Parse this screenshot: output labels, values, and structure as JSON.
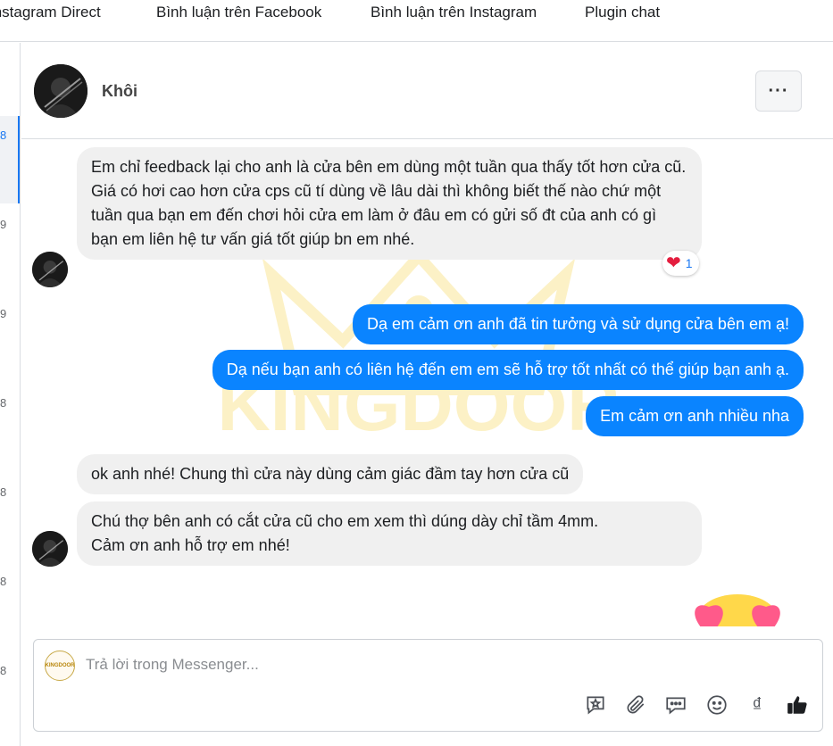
{
  "tabs": [
    {
      "label": "Instagram Direct"
    },
    {
      "label": "Bình luận trên Facebook"
    },
    {
      "label": "Bình luận trên Instagram"
    },
    {
      "label": "Plugin chat"
    }
  ],
  "left_list": {
    "numbers": [
      "8",
      "9",
      "9",
      "8",
      "8",
      "8",
      "8"
    ]
  },
  "conversation": {
    "contact_name": "Khôi",
    "more_label": "···"
  },
  "messages": [
    {
      "direction": "in",
      "text": "Em chỉ feedback lại cho anh là cửa bên em dùng một tuần qua thấy tốt hơn cửa cũ. Giá có hơi cao hơn cửa cps cũ tí dùng về lâu dài thì không biết thế nào chứ một tuần qua bạn em đến chơi hỏi cửa em làm ở đâu em có gửi số đt của anh có gì bạn em liên hệ tư vấn giá tốt giúp bn em nhé."
    },
    {
      "direction": "out",
      "text": "Dạ em cảm ơn anh đã tin tưởng và sử dụng cửa bên em ạ!"
    },
    {
      "direction": "out",
      "text": "Dạ nếu bạn anh có liên hệ đến em em sẽ hỗ trợ tốt nhất có thể giúp bạn anh ạ."
    },
    {
      "direction": "out",
      "text": "Em cảm ơn anh nhiều nha"
    },
    {
      "direction": "in",
      "text": "ok anh nhé! Chung thì cửa này dùng cảm giác đầm tay hơn cửa cũ"
    },
    {
      "direction": "in",
      "text": "Chú thợ bên anh có cắt cửa cũ cho em xem thì dúng dày chỉ tầm 4mm.\nCảm ơn anh hỗ trợ em nhé!"
    }
  ],
  "reaction": {
    "emoji": "❤",
    "count": "1"
  },
  "watermark": {
    "text": "KINGDOOR"
  },
  "composer": {
    "placeholder": "Trả lời trong Messenger...",
    "page_logo_text": "KINGDOOR",
    "currency_symbol": "₫"
  },
  "colors": {
    "outgoing_bubble": "#0a84ff",
    "incoming_bubble": "#f0f0f0",
    "accent": "#1877f2",
    "watermark": "#f2c200"
  }
}
